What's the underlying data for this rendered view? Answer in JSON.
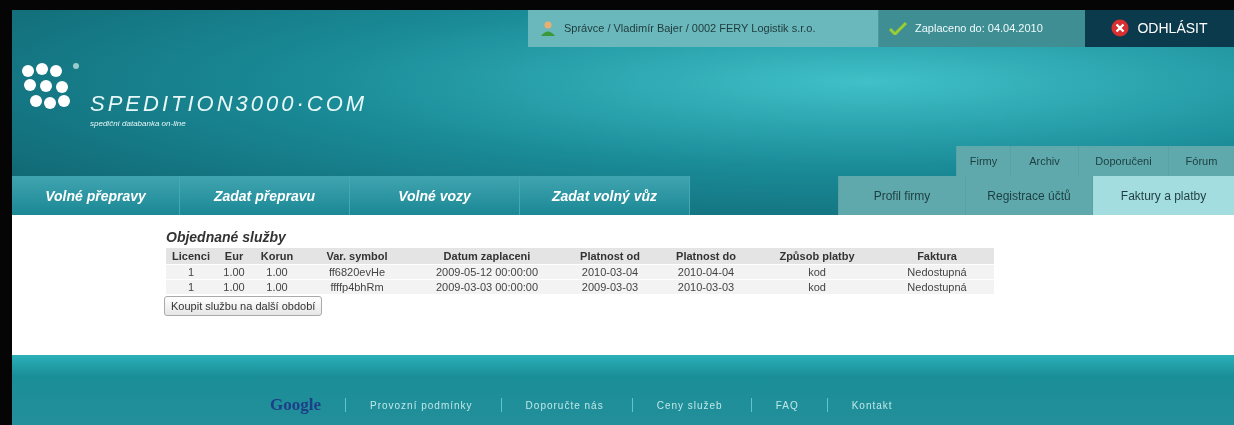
{
  "top_bar": {
    "user": "Správce / Vladimír Bajer / 0002 FERY Logistik s.r.o.",
    "paid_until": "Zaplaceno do: 04.04.2010",
    "logout": "ODHLÁSIT"
  },
  "logo": {
    "name": "SPEDITION3000·COM",
    "tagline": "spediční databanka on-line"
  },
  "secondary_tabs": [
    {
      "label": "Firmy",
      "selected": false
    },
    {
      "label": "Archiv",
      "selected": false
    },
    {
      "label": "Doporučeni",
      "selected": false
    },
    {
      "label": "Fórum",
      "selected": false
    }
  ],
  "main_nav": [
    {
      "label": "Volné přepravy"
    },
    {
      "label": "Zadat přepravu"
    },
    {
      "label": "Volné vozy"
    },
    {
      "label": "Zadat volný vůz"
    }
  ],
  "account_tabs": [
    {
      "label": "Profil firmy",
      "selected": false
    },
    {
      "label": "Registrace účtů",
      "selected": false
    },
    {
      "label": "Faktury a platby",
      "selected": true
    }
  ],
  "section": {
    "title": "Objednané služby",
    "table": {
      "columns": [
        "Licenci",
        "Eur",
        "Korun",
        "Var. symbol",
        "Datum zaplaceni",
        "Platnost od",
        "Platnost do",
        "Způsob platby",
        "Faktura"
      ],
      "rows": [
        [
          "1",
          "1.00",
          "1.00",
          "ff6820evHe",
          "2009-05-12 00:00:00",
          "2010-03-04",
          "2010-04-04",
          "kod",
          "Nedostupná"
        ],
        [
          "1",
          "1.00",
          "1.00",
          "ffffp4bhRm",
          "2009-03-03 00:00:00",
          "2009-03-03",
          "2010-03-03",
          "kod",
          "Nedostupná"
        ]
      ]
    },
    "button": "Koupit službu na další období"
  },
  "footer": {
    "logo": "Google",
    "links": [
      "Provozní podmínky",
      "Doporučte nás",
      "Ceny služeb",
      "FAQ",
      "Kontakt"
    ]
  }
}
